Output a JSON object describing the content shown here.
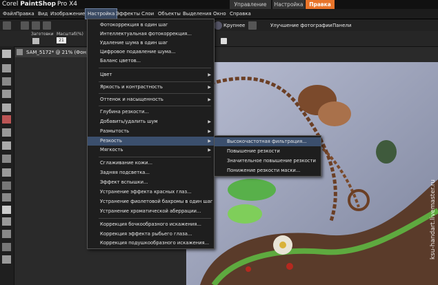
{
  "app": {
    "brand_left": "Corel",
    "brand_main": "PaintShop",
    "brand_right": "Pro X4"
  },
  "workspace_tabs": [
    {
      "label": "Управление"
    },
    {
      "label": "Настройка"
    },
    {
      "label": "Правка"
    }
  ],
  "menubar": [
    {
      "label": "Файл"
    },
    {
      "label": "Правка"
    },
    {
      "label": "Вид"
    },
    {
      "label": "Изображение"
    },
    {
      "label": "Настройка"
    },
    {
      "label": "Эффекты"
    },
    {
      "label": "Слои"
    },
    {
      "label": "Объекты"
    },
    {
      "label": "Выделения"
    },
    {
      "label": "Окно"
    },
    {
      "label": "Справка"
    }
  ],
  "toolbar": {
    "zoom_in_label": "Крупнее",
    "enhance_label": "Улучшение фотографии",
    "panels_label": "Панели",
    "preset_label": "Заготовки",
    "scale_label": "Масштаб(%)",
    "scale_value": "21"
  },
  "document": {
    "tab_label": "SAM_5172* @ 21% (Фон)"
  },
  "adjust_menu": {
    "items": [
      {
        "label": "Фотокоррекция в один шаг"
      },
      {
        "label": "Интеллектуальная фотокоррекция..."
      },
      {
        "label": "Удаление шума в один шаг"
      },
      {
        "label": "Цифровое подавление шума..."
      },
      {
        "label": "Баланс цветов..."
      },
      {
        "label": "Цвет"
      },
      {
        "label": "Яркость и контрастность"
      },
      {
        "label": "Оттенок и насыщенность"
      },
      {
        "label": "Глубина резкости..."
      },
      {
        "label": "Добавить/удалить шум"
      },
      {
        "label": "Размытость"
      },
      {
        "label": "Резкость"
      },
      {
        "label": "Мягкость"
      },
      {
        "label": "Сглаживание кожи..."
      },
      {
        "label": "Задняя подсветка..."
      },
      {
        "label": "Эффект вспышки..."
      },
      {
        "label": "Устранение эффекта красных глаз..."
      },
      {
        "label": "Устранение фиолетовой бахромы в один шаг"
      },
      {
        "label": "Устранение хроматической аберрации..."
      },
      {
        "label": "Коррекция бочкообразного искажения..."
      },
      {
        "label": "Коррекция эффекта рыбьего глаза..."
      },
      {
        "label": "Коррекция подушкообразного искажения..."
      }
    ]
  },
  "sharpen_submenu": {
    "items": [
      {
        "label": "Высокочастотная фильтрация..."
      },
      {
        "label": "Повышение резкости"
      },
      {
        "label": "Значительное повышение резкости"
      },
      {
        "label": "Понижение резкости маски..."
      }
    ]
  },
  "watermark": "ksu-handart.livemaster.ru",
  "colors": {
    "accent_tab": "#e8742a",
    "menu_highlight": "#3b4f6d"
  }
}
